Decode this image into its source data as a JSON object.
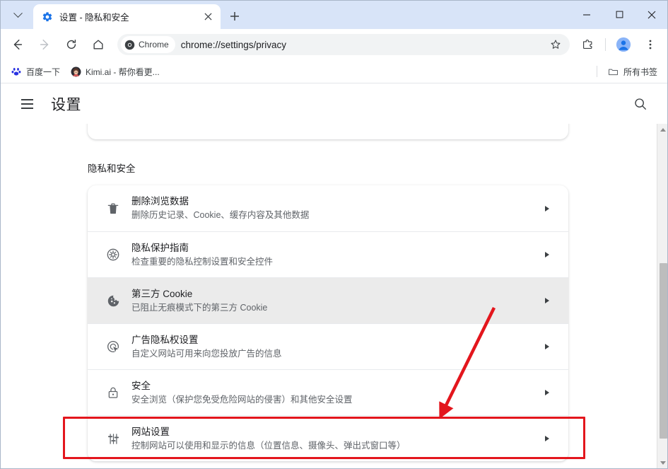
{
  "window": {
    "controls": {
      "minimize": "−",
      "maximize": "□",
      "close": "✕"
    }
  },
  "tabstrip": {
    "tab_search_label": "搜索标签页",
    "tab": {
      "title": "设置 - 隐私和安全",
      "favicon": "settings-gear-icon",
      "close_label": "✕"
    },
    "new_tab_label": "+"
  },
  "toolbar": {
    "back_label": "←",
    "forward_label": "→",
    "reload_label": "⟳",
    "home_label": "⌂",
    "chip_label": "Chrome",
    "url": "chrome://settings/privacy",
    "bookmark_star": "☆",
    "extensions_label": "扩展程序",
    "profile_label": "个人资料",
    "menu_label": "⋮"
  },
  "bookmarks": {
    "items": [
      {
        "label": "百度一下",
        "icon": "baidu-paw-icon"
      },
      {
        "label": "Kimi.ai - 帮你看更...",
        "icon": "kimi-avatar-icon"
      }
    ],
    "all_bookmarks_label": "所有书签",
    "all_bookmarks_icon": "folder-icon"
  },
  "settings": {
    "menu_label": "主菜单",
    "title": "设置",
    "search_label": "搜索设置"
  },
  "main": {
    "section_title": "隐私和安全",
    "rows": [
      {
        "icon": "trash-icon",
        "title": "删除浏览数据",
        "subtitle": "删除历史记录、Cookie、缓存内容及其他数据",
        "highlight": false
      },
      {
        "icon": "privacy-guide-icon",
        "title": "隐私保护指南",
        "subtitle": "检查重要的隐私控制设置和安全控件",
        "highlight": false
      },
      {
        "icon": "cookie-icon",
        "title": "第三方 Cookie",
        "subtitle": "已阻止无痕模式下的第三方 Cookie",
        "highlight": true
      },
      {
        "icon": "ad-privacy-icon",
        "title": "广告隐私权设置",
        "subtitle": "自定义网站可用来向您投放广告的信息",
        "highlight": false
      },
      {
        "icon": "lock-icon",
        "title": "安全",
        "subtitle": "安全浏览（保护您免受危险网站的侵害）和其他安全设置",
        "highlight": false
      },
      {
        "icon": "tune-sliders-icon",
        "title": "网站设置",
        "subtitle": "控制网站可以使用和显示的信息（位置信息、摄像头、弹出式窗口等）",
        "highlight": false
      }
    ]
  },
  "annotations": {
    "highlight_color": "#e3161d",
    "arrow_color": "#e3161d",
    "box_target": "网站设置",
    "arrow_points_to": "网站设置"
  },
  "colors": {
    "tabstrip_bg": "#d8e4f8",
    "accent_blue": "#1a73e8",
    "text_primary": "#202124",
    "text_secondary": "#5f6368",
    "row_highlight": "#ebebeb"
  }
}
